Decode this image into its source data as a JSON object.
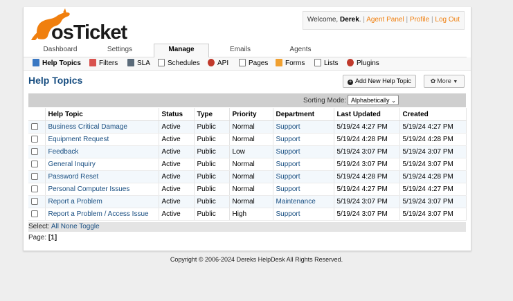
{
  "logo": {
    "text": "osTicket"
  },
  "welcome": {
    "prefix": "Welcome, ",
    "user": "Derek",
    "suffix": ".",
    "links": [
      "Agent Panel",
      "Profile",
      "Log Out"
    ]
  },
  "nav": {
    "tabs": [
      "Dashboard",
      "Settings",
      "Manage",
      "Emails",
      "Agents"
    ],
    "active": "Manage"
  },
  "subnav": {
    "items": [
      {
        "label": "Help Topics",
        "icon": "help-topics-icon",
        "color": "#3a78c3"
      },
      {
        "label": "Filters",
        "icon": "filters-icon",
        "color": "#d9534f"
      },
      {
        "label": "SLA",
        "icon": "sla-icon",
        "color": "#5b6b7a"
      },
      {
        "label": "Schedules",
        "icon": "schedules-icon",
        "color": "#888888"
      },
      {
        "label": "API",
        "icon": "api-icon",
        "color": "#c0392b"
      },
      {
        "label": "Pages",
        "icon": "pages-icon",
        "color": "#777777"
      },
      {
        "label": "Forms",
        "icon": "forms-icon",
        "color": "#f0a030"
      },
      {
        "label": "Lists",
        "icon": "lists-icon",
        "color": "#777777"
      },
      {
        "label": "Plugins",
        "icon": "plugins-icon",
        "color": "#c0392b"
      }
    ]
  },
  "page": {
    "title": "Help Topics",
    "add_button": "Add New Help Topic",
    "more_button": "More"
  },
  "sorting": {
    "label": "Sorting Mode:",
    "value": "Alphabetically"
  },
  "table": {
    "columns": [
      "Help Topic",
      "Status",
      "Type",
      "Priority",
      "Department",
      "Last Updated",
      "Created"
    ],
    "rows": [
      {
        "topic": "Business Critical Damage",
        "status": "Active",
        "type": "Public",
        "priority": "Normal",
        "department": "Support",
        "updated": "5/19/24 4:27 PM",
        "created": "5/19/24 4:27 PM"
      },
      {
        "topic": "Equipment Request",
        "status": "Active",
        "type": "Public",
        "priority": "Normal",
        "department": "Support",
        "updated": "5/19/24 4:28 PM",
        "created": "5/19/24 4:28 PM"
      },
      {
        "topic": "Feedback",
        "status": "Active",
        "type": "Public",
        "priority": "Low",
        "department": "Support",
        "updated": "5/19/24 3:07 PM",
        "created": "5/19/24 3:07 PM"
      },
      {
        "topic": "General Inquiry",
        "status": "Active",
        "type": "Public",
        "priority": "Normal",
        "department": "Support",
        "updated": "5/19/24 3:07 PM",
        "created": "5/19/24 3:07 PM"
      },
      {
        "topic": "Password Reset",
        "status": "Active",
        "type": "Public",
        "priority": "Normal",
        "department": "Support",
        "updated": "5/19/24 4:28 PM",
        "created": "5/19/24 4:28 PM"
      },
      {
        "topic": "Personal Computer Issues",
        "status": "Active",
        "type": "Public",
        "priority": "Normal",
        "department": "Support",
        "updated": "5/19/24 4:27 PM",
        "created": "5/19/24 4:27 PM"
      },
      {
        "topic": "Report a Problem",
        "status": "Active",
        "type": "Public",
        "priority": "Normal",
        "department": "Maintenance",
        "updated": "5/19/24 3:07 PM",
        "created": "5/19/24 3:07 PM"
      },
      {
        "topic": "Report a Problem / Access Issue",
        "status": "Active",
        "type": "Public",
        "priority": "High",
        "department": "Support",
        "updated": "5/19/24 3:07 PM",
        "created": "5/19/24 3:07 PM"
      }
    ]
  },
  "select": {
    "label": "Select:",
    "all": "All",
    "none": "None",
    "toggle": "Toggle"
  },
  "pagination": {
    "label": "Page:",
    "current": "[1]"
  },
  "footer": {
    "text": "Copyright © 2006-2024 Dereks HelpDesk All Rights Reserved."
  },
  "colors": {
    "brand_orange": "#f07f0e",
    "link_blue": "#184e81"
  }
}
